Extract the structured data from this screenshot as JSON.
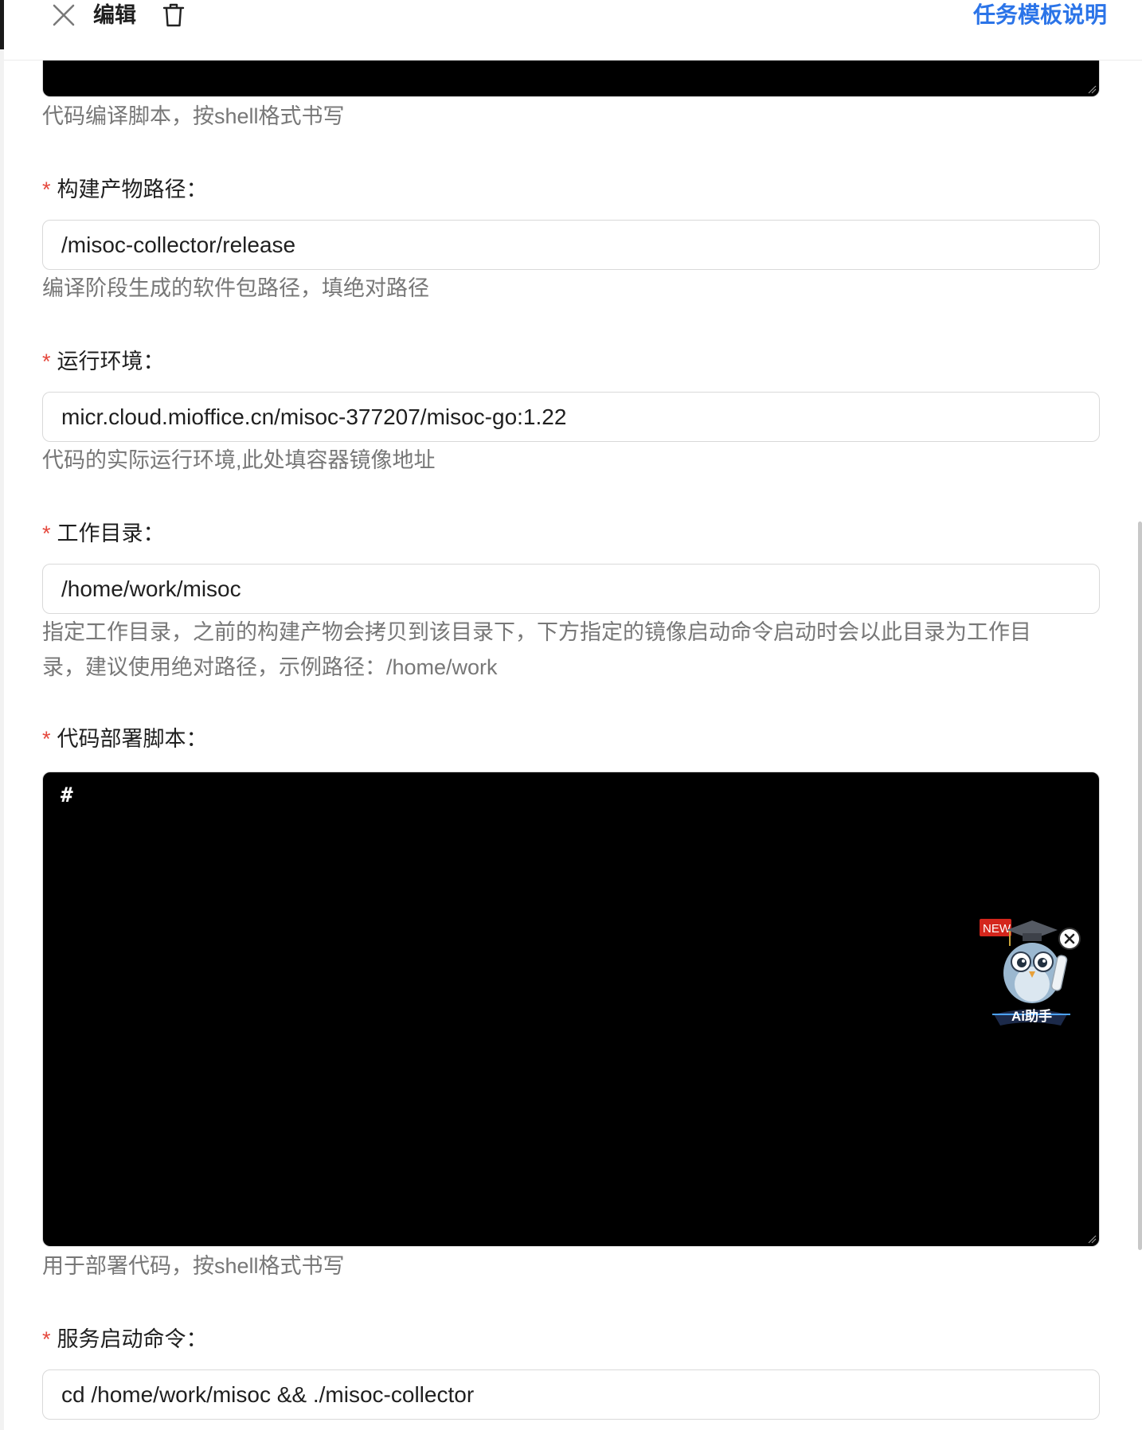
{
  "header": {
    "title": "编辑",
    "doc_link": "任务模板说明"
  },
  "fields": {
    "compile_hint": "代码编译脚本，按shell格式书写",
    "artifact_path": {
      "label": "构建产物路径：",
      "value": "/misoc-collector/release",
      "hint": "编译阶段生成的软件包路径，填绝对路径"
    },
    "runtime_env": {
      "label": "运行环境：",
      "value": "micr.cloud.mioffice.cn/misoc-377207/misoc-go:1.22",
      "hint": "代码的实际运行环境,此处填容器镜像地址"
    },
    "work_dir": {
      "label": "工作目录：",
      "value": "/home/work/misoc",
      "hint_line1": "指定工作目录，之前的构建产物会拷贝到该目录下，下方指定的镜像启动命令启动时会以此目录为工作目",
      "hint_line2": "录，建议使用绝对路径，示例路径：/home/work"
    },
    "deploy_script": {
      "label": "代码部署脚本：",
      "value": "#",
      "hint": "用于部署代码，按shell格式书写"
    },
    "start_cmd": {
      "label": "服务启动命令：",
      "value": "cd /home/work/misoc && ./misoc-collector"
    },
    "required_mark": "*"
  },
  "ai_assistant": {
    "badge": "NEW",
    "label": "Ai助手",
    "icon": "owl-mascot-icon"
  },
  "colors": {
    "accent": "#2b74e8",
    "required": "#e5483d",
    "code_bg": "#000000"
  }
}
